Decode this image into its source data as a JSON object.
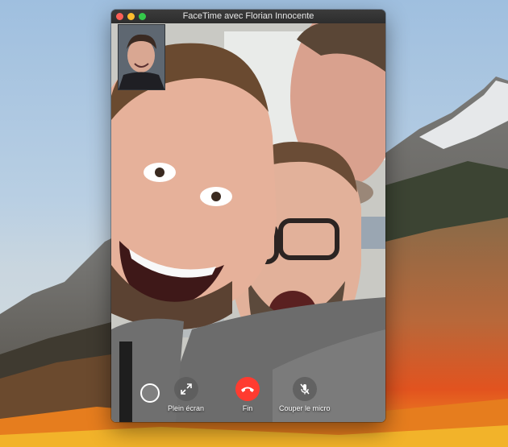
{
  "window": {
    "title": "FaceTime avec Florian Innocente"
  },
  "controls": {
    "record": {
      "icon": "record-icon"
    },
    "fullscreen": {
      "label": "Plein écran",
      "icon": "expand-arrows-icon"
    },
    "end_call": {
      "label": "Fin",
      "icon": "phone-hangup-icon",
      "color": "#ff3b30"
    },
    "mute": {
      "label": "Couper le micro",
      "icon": "microphone-slash-icon"
    }
  },
  "colors": {
    "close": "#fc5f57",
    "minimize": "#fdbc2e",
    "maximize": "#34c84a",
    "titlebar": "#2d2d2d"
  }
}
